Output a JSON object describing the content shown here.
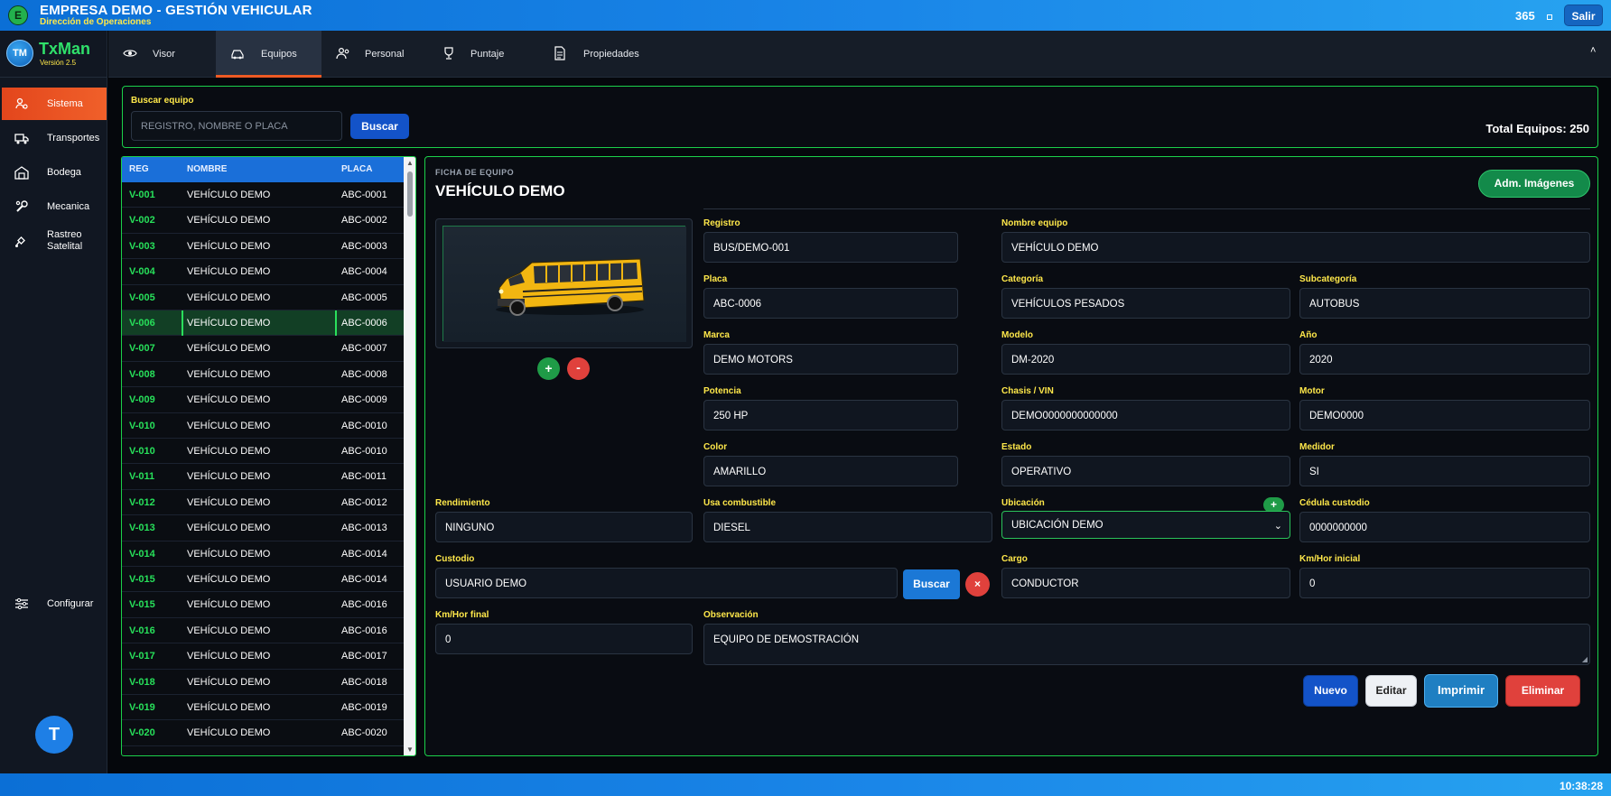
{
  "app": {
    "company_badge": "E",
    "company_name": "EMPRESA DEMO - GESTIÓN VEHICULAR",
    "company_sub": "Dirección de Operaciones",
    "counter": "365",
    "logout_label": "Salir",
    "clock": "10:38:28"
  },
  "brand": {
    "logo": "TM",
    "name": "TxMan",
    "version": "Versión 2.5"
  },
  "sidebar": {
    "items": [
      {
        "label": "Sistema",
        "icon": "gear-users-icon",
        "active": true
      },
      {
        "label": "Transportes",
        "icon": "truck-icon",
        "active": false
      },
      {
        "label": "Bodega",
        "icon": "warehouse-icon",
        "active": false
      },
      {
        "label": "Mecanica",
        "icon": "wrench-icon",
        "active": false
      },
      {
        "label": "Rastreo Satelital",
        "icon": "satellite-icon",
        "active": false
      }
    ],
    "config_label": "Configurar",
    "avatar": "T"
  },
  "tabs": [
    {
      "label": "Visor",
      "icon": "eye-icon",
      "active": false
    },
    {
      "label": "Equipos",
      "icon": "vehicle-icon",
      "active": true
    },
    {
      "label": "Personal",
      "icon": "people-icon",
      "active": false
    },
    {
      "label": "Puntaje",
      "icon": "trophy-icon",
      "active": false
    },
    {
      "label": "Propiedades",
      "icon": "document-icon",
      "active": false
    }
  ],
  "search": {
    "label": "Buscar equipo",
    "placeholder": "REGISTRO, NOMBRE O PLACA",
    "button": "Buscar",
    "total": "Total Equipos: 250"
  },
  "list": {
    "headers": {
      "reg": "REG",
      "nombre": "NOMBRE",
      "placa": "PLACA"
    },
    "rows": [
      {
        "reg": "V-001",
        "nombre": "VEHÍCULO DEMO",
        "placa": "ABC-0001"
      },
      {
        "reg": "V-002",
        "nombre": "VEHÍCULO DEMO",
        "placa": "ABC-0002"
      },
      {
        "reg": "V-003",
        "nombre": "VEHÍCULO DEMO",
        "placa": "ABC-0003"
      },
      {
        "reg": "V-004",
        "nombre": "VEHÍCULO DEMO",
        "placa": "ABC-0004"
      },
      {
        "reg": "V-005",
        "nombre": "VEHÍCULO DEMO",
        "placa": "ABC-0005"
      },
      {
        "reg": "V-006",
        "nombre": "VEHÍCULO DEMO",
        "placa": "ABC-0006",
        "selected": true
      },
      {
        "reg": "V-007",
        "nombre": "VEHÍCULO DEMO",
        "placa": "ABC-0007"
      },
      {
        "reg": "V-008",
        "nombre": "VEHÍCULO DEMO",
        "placa": "ABC-0008"
      },
      {
        "reg": "V-009",
        "nombre": "VEHÍCULO DEMO",
        "placa": "ABC-0009"
      },
      {
        "reg": "V-010",
        "nombre": "VEHÍCULO DEMO",
        "placa": "ABC-0010"
      },
      {
        "reg": "V-010",
        "nombre": "VEHÍCULO DEMO",
        "placa": "ABC-0010"
      },
      {
        "reg": "V-011",
        "nombre": "VEHÍCULO DEMO",
        "placa": "ABC-0011"
      },
      {
        "reg": "V-012",
        "nombre": "VEHÍCULO DEMO",
        "placa": "ABC-0012"
      },
      {
        "reg": "V-013",
        "nombre": "VEHÍCULO DEMO",
        "placa": "ABC-0013"
      },
      {
        "reg": "V-014",
        "nombre": "VEHÍCULO DEMO",
        "placa": "ABC-0014"
      },
      {
        "reg": "V-015",
        "nombre": "VEHÍCULO DEMO",
        "placa": "ABC-0014"
      },
      {
        "reg": "V-015",
        "nombre": "VEHÍCULO DEMO",
        "placa": "ABC-0016"
      },
      {
        "reg": "V-016",
        "nombre": "VEHÍCULO DEMO",
        "placa": "ABC-0016"
      },
      {
        "reg": "V-017",
        "nombre": "VEHÍCULO DEMO",
        "placa": "ABC-0017"
      },
      {
        "reg": "V-018",
        "nombre": "VEHÍCULO DEMO",
        "placa": "ABC-0018"
      },
      {
        "reg": "V-019",
        "nombre": "VEHÍCULO DEMO",
        "placa": "ABC-0019"
      },
      {
        "reg": "V-020",
        "nombre": "VEHÍCULO DEMO",
        "placa": "ABC-0020"
      }
    ]
  },
  "ficha": {
    "section_label": "FICHA DE EQUIPO",
    "title": "VEHÍCULO DEMO",
    "adm_images": "Adm. Imágenes",
    "image_add": "+",
    "image_remove": "-"
  },
  "fields": {
    "registro": {
      "label": "Registro",
      "value": "BUS/DEMO-001"
    },
    "nombre": {
      "label": "Nombre equipo",
      "value": "VEHÍCULO DEMO"
    },
    "placa": {
      "label": "Placa",
      "value": "ABC-0006"
    },
    "categoria": {
      "label": "Categoría",
      "value": "VEHÍCULOS PESADOS"
    },
    "subcategoria": {
      "label": "Subcategoría",
      "value": "AUTOBUS"
    },
    "marca": {
      "label": "Marca",
      "value": "DEMO MOTORS"
    },
    "modelo": {
      "label": "Modelo",
      "value": "DM-2020"
    },
    "anio": {
      "label": "Año",
      "value": "2020"
    },
    "potencia": {
      "label": "Potencia",
      "value": "250 HP"
    },
    "chasis": {
      "label": "Chasis / VIN",
      "value": "DEMO0000000000000"
    },
    "motor": {
      "label": "Motor",
      "value": "DEMO0000"
    },
    "color": {
      "label": "Color",
      "value": "AMARILLO"
    },
    "estado": {
      "label": "Estado",
      "value": "OPERATIVO"
    },
    "medidor": {
      "label": "Medidor",
      "value": "SI"
    },
    "rendimiento": {
      "label": "Rendimiento",
      "value": "NINGUNO"
    },
    "combustible": {
      "label": "Usa combustible",
      "value": "DIESEL"
    },
    "ubicacion": {
      "label": "Ubicación",
      "value": "UBICACIÓN DEMO",
      "add": "+"
    },
    "cedula": {
      "label": "Cédula custodio",
      "value": "0000000000"
    },
    "custodio": {
      "label": "Custodio",
      "value": "USUARIO DEMO",
      "search": "Buscar",
      "clear": "×"
    },
    "cargo": {
      "label": "Cargo",
      "value": "CONDUCTOR"
    },
    "km_inicial": {
      "label": "Km/Hor inicial",
      "value": "0"
    },
    "km_final": {
      "label": "Km/Hor final",
      "value": "0"
    },
    "observacion": {
      "label": "Observación",
      "value": "EQUIPO DE DEMOSTRACIÓN"
    }
  },
  "actions": {
    "nuevo": "Nuevo",
    "editar": "Editar",
    "imprimir": "Imprimir",
    "eliminar": "Eliminar"
  }
}
